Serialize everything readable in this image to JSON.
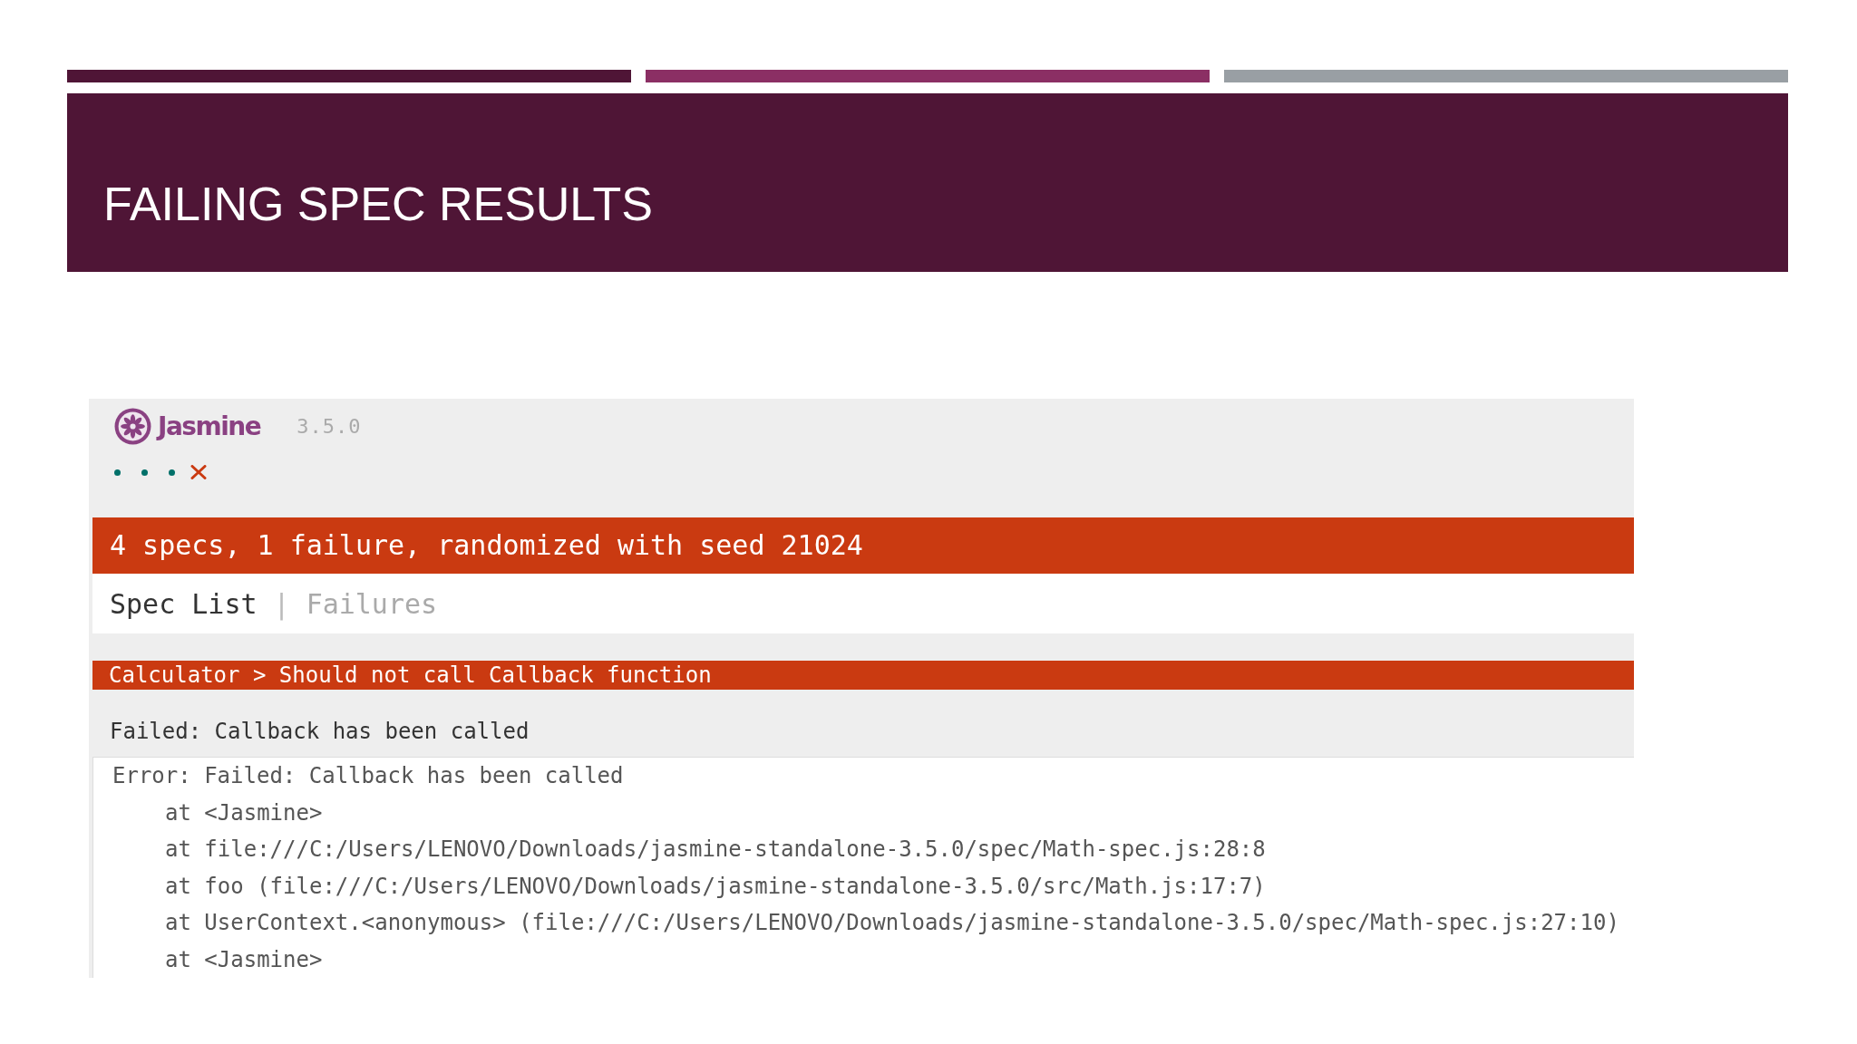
{
  "slide": {
    "title": "FAILING SPEC RESULTS"
  },
  "reporter": {
    "logo": "Jasmine",
    "version": "3.5.0",
    "symbols": [
      {
        "kind": "passed"
      },
      {
        "kind": "passed"
      },
      {
        "kind": "passed"
      },
      {
        "kind": "failed"
      }
    ],
    "summary": "4 specs, 1 failure, randomized with seed 21024",
    "tabs": [
      {
        "label": "Spec List",
        "selected": true
      },
      {
        "label": "Failures",
        "selected": false
      }
    ],
    "separator": "|",
    "failures": [
      {
        "title": "Calculator > Should not call Callback function",
        "message": "Failed: Callback has been called",
        "error": "Error: Failed: Callback has been called",
        "frames": [
          "at <Jasmine>",
          "at file:///C:/Users/LENOVO/Downloads/jasmine-standalone-3.5.0/spec/Math-spec.js:28:8",
          "at foo (file:///C:/Users/LENOVO/Downloads/jasmine-standalone-3.5.0/src/Math.js:17:7)",
          "at UserContext.<anonymous> (file:///C:/Users/LENOVO/Downloads/jasmine-standalone-3.5.0/spec/Math-spec.js:27:10)",
          "at <Jasmine>"
        ]
      }
    ]
  }
}
